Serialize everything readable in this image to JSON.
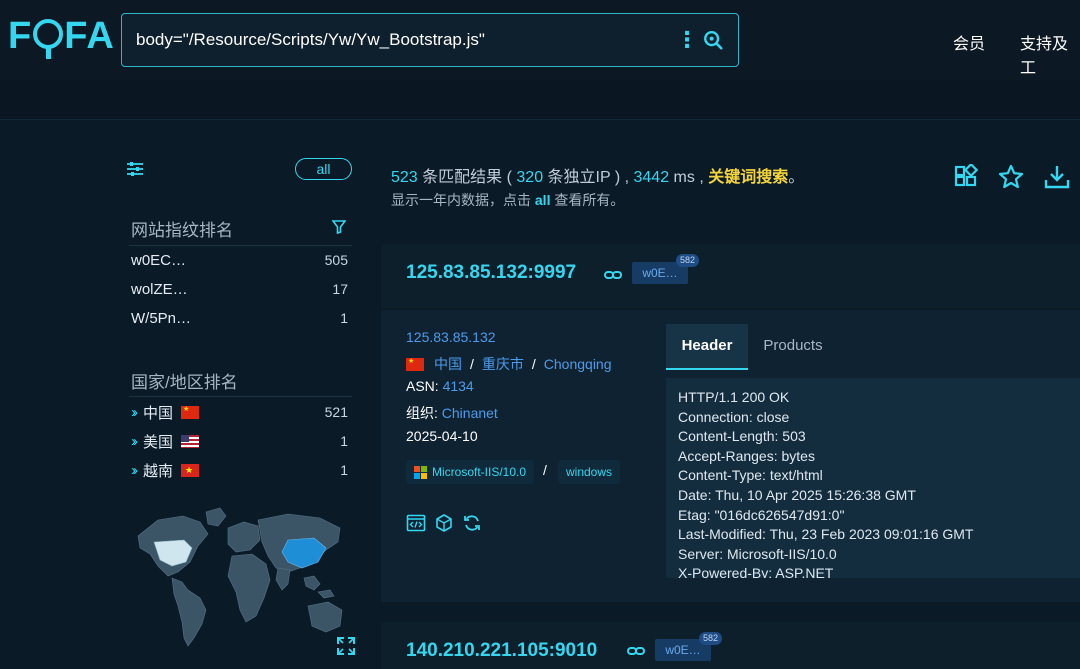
{
  "header": {
    "logo": "FOFA",
    "search": {
      "value": "body=\"/Resource/Scripts/Yw/Yw_Bootstrap.js\""
    },
    "nav": [
      "会员",
      "支持及工"
    ]
  },
  "sidebar": {
    "all_label": "all",
    "fingerprint_title": "网站指纹排名",
    "fingerprints": [
      {
        "label": "w0EC…",
        "count": "505"
      },
      {
        "label": "wolZE…",
        "count": "17"
      },
      {
        "label": "W/5Pn…",
        "count": "1"
      }
    ],
    "country_title": "国家/地区排名",
    "countries": [
      {
        "label": "中国",
        "count": "521"
      },
      {
        "label": "美国",
        "count": "1"
      },
      {
        "label": "越南",
        "count": "1"
      }
    ]
  },
  "summary": {
    "count": "523",
    "count_label": "条匹配结果 (",
    "ip_count": "320",
    "ip_label": "条独立IP ) ,",
    "ms": "3442",
    "ms_label": "ms ,",
    "keyword": "关键词搜索",
    "period": "。",
    "line2_pre": "显示一年内数据，点击",
    "line2_all": "all",
    "line2_post": "查看所有。"
  },
  "results": [
    {
      "host": "125.83.85.132:9997",
      "tag": "w0E…",
      "tag_count": "582",
      "ip": "125.83.85.132",
      "country": "中国",
      "region": "重庆市",
      "city": "Chongqing",
      "asn_label": "ASN:",
      "asn": "4134",
      "org_label": "组织:",
      "org": "Chinanet",
      "date": "2025-04-10",
      "server_pill": "Microsoft-IIS/10.0",
      "sep": "/",
      "os_pill": "windows",
      "tabs": [
        "Header",
        "Products"
      ],
      "header_lines": [
        "HTTP/1.1 200 OK",
        "Connection: close",
        "Content-Length: 503",
        "Accept-Ranges: bytes",
        "Content-Type: text/html",
        "Date: Thu, 10 Apr 2025 15:26:38 GMT",
        "Etag: \"016dc626547d91:0\"",
        "Last-Modified: Thu, 23 Feb 2023 09:01:16 GMT",
        "Server: Microsoft-IIS/10.0",
        "X-Powered-By: ASP.NET"
      ]
    },
    {
      "host": "140.210.221.105:9010",
      "tag": "w0E…",
      "tag_count": "582"
    }
  ],
  "colors": {
    "accent": "#33d7f0",
    "link": "#4d9bea",
    "highlight": "#f5d63a",
    "background": "#0b1a27"
  }
}
